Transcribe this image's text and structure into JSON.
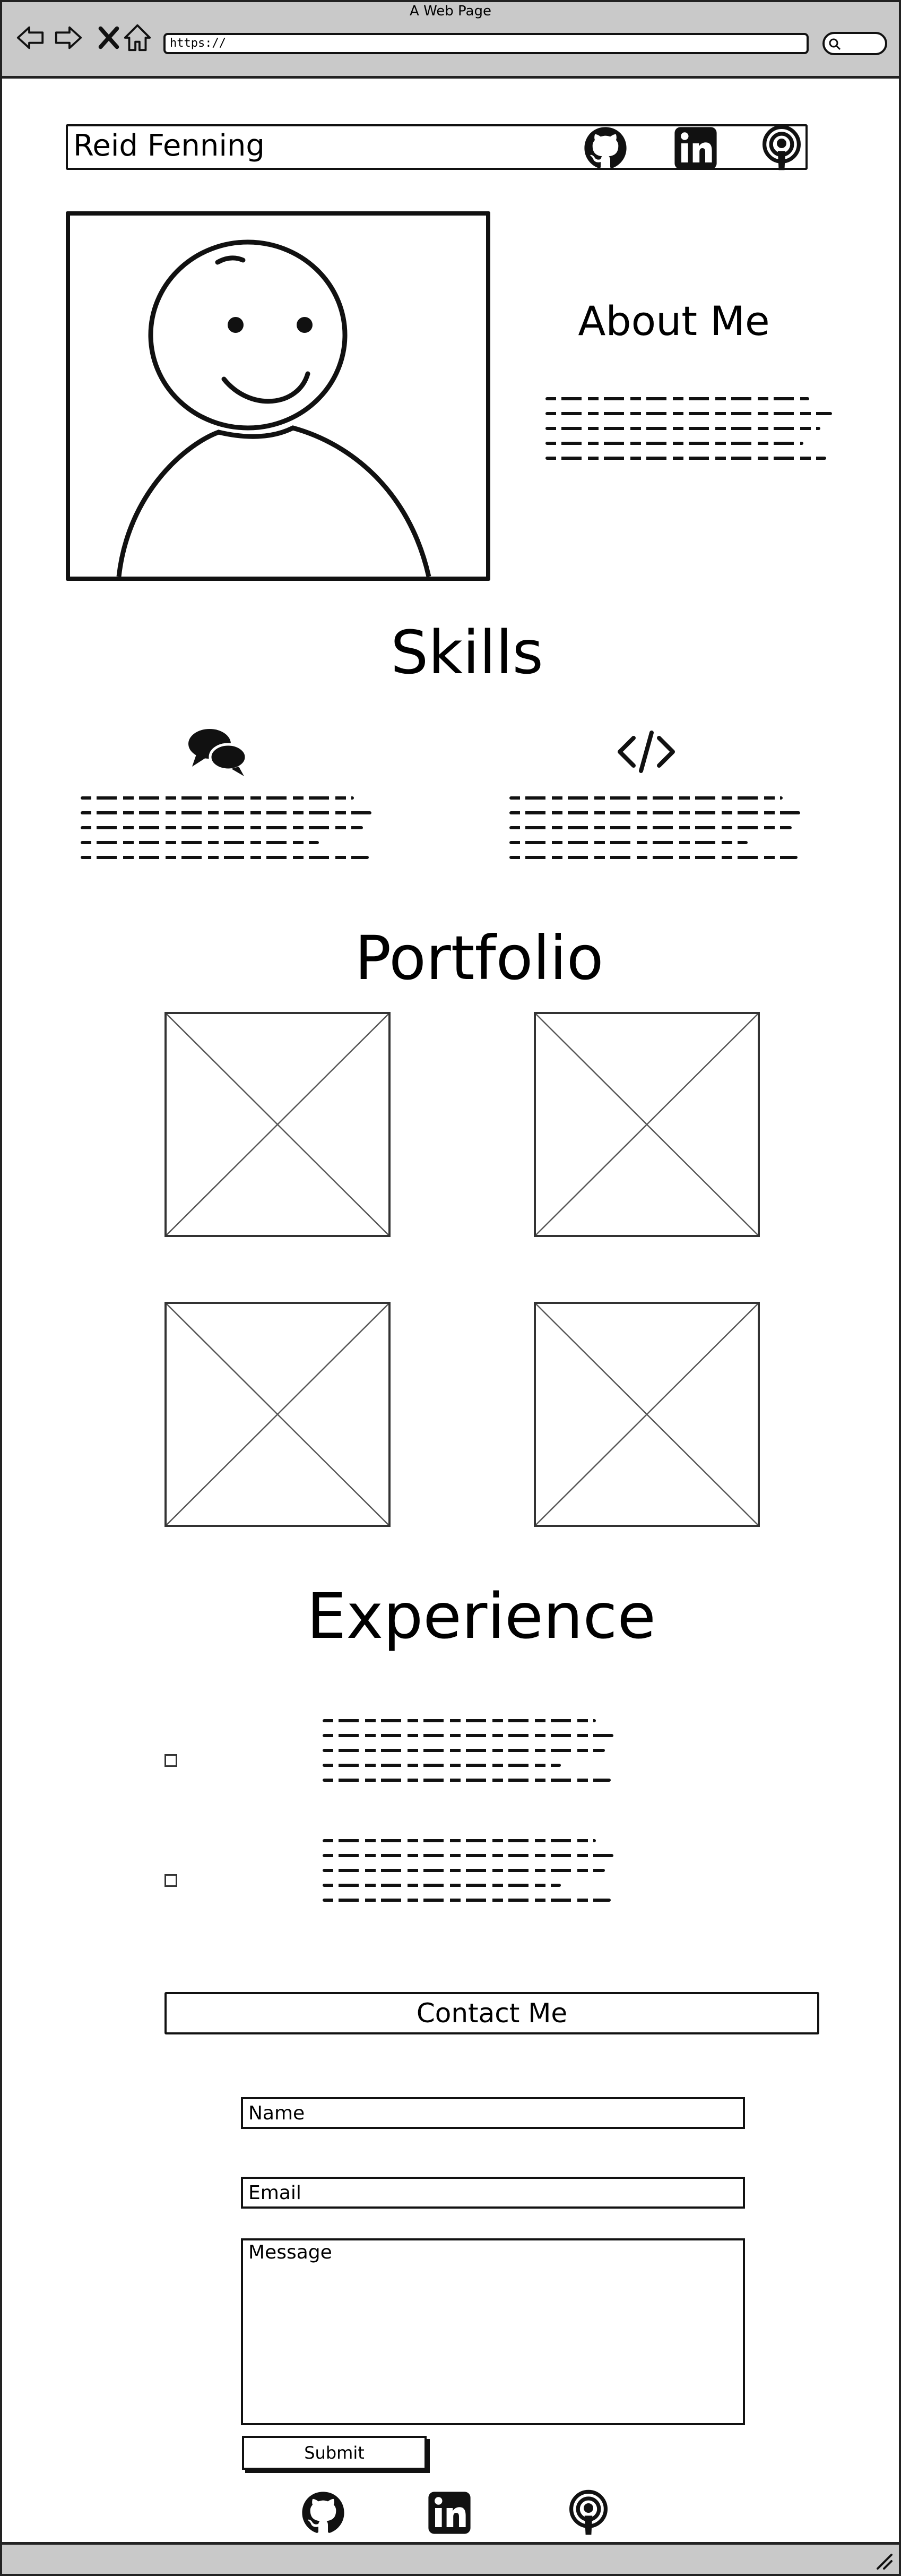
{
  "browser": {
    "window_title": "A Web Page",
    "url": "https://",
    "nav_icons": [
      "back-arrow-icon",
      "forward-arrow-icon",
      "stop-x-icon",
      "home-icon"
    ]
  },
  "header": {
    "site_name": "Reid Fenning",
    "social_icons": [
      "github-icon",
      "linkedin-icon",
      "podcast-icon"
    ]
  },
  "about": {
    "title": "About Me",
    "text_lines": 5
  },
  "skills": {
    "title": "Skills",
    "items": [
      {
        "icon": "chat-bubbles-icon",
        "text_lines": 5
      },
      {
        "icon": "code-brackets-icon",
        "text_lines": 5
      }
    ]
  },
  "portfolio": {
    "title": "Portfolio",
    "image_placeholders": 4
  },
  "experience": {
    "title": "Experience",
    "entries": [
      {
        "text_lines": 5
      },
      {
        "text_lines": 5
      }
    ]
  },
  "contact": {
    "title": "Contact Me",
    "name_placeholder": "Name",
    "email_placeholder": "Email",
    "message_placeholder": "Message",
    "submit_label": "Submit"
  },
  "footer": {
    "social_icons": [
      "github-icon",
      "linkedin-icon",
      "podcast-icon"
    ]
  },
  "colors": {
    "chrome": "#c9c9c9",
    "ink": "#111111",
    "page": "#ffffff"
  }
}
